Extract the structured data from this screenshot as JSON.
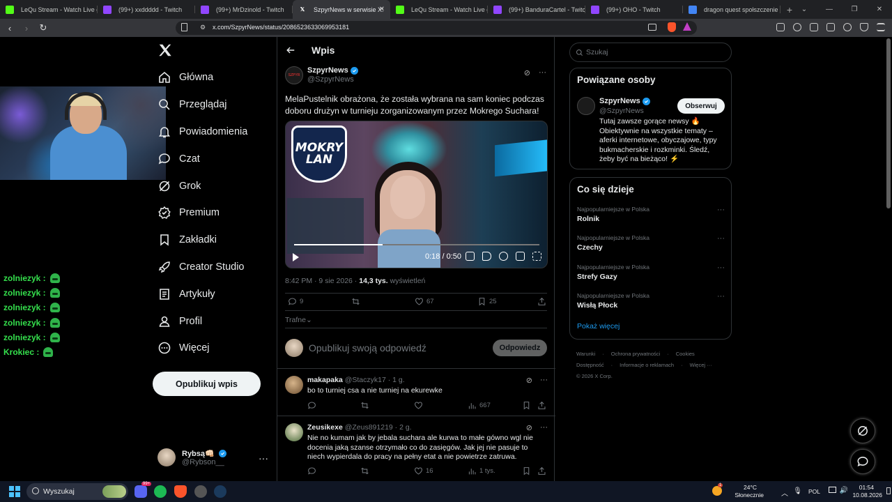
{
  "browser": {
    "tabs": [
      {
        "title": "LeQu Stream - Watch Live on",
        "icon": "kick-icon",
        "color": "#53fc18"
      },
      {
        "title": "(99+) xxddddd - Twitch",
        "icon": "twitch-icon",
        "color": "#9146ff"
      },
      {
        "title": "(99+) MrDzinold - Twitch",
        "icon": "twitch-icon",
        "color": "#9146ff"
      },
      {
        "title": "SzpyrNews w serwisie X:",
        "icon": "x-icon",
        "color": "#ffffff",
        "active": true
      },
      {
        "title": "LeQu Stream - Watch Live on",
        "icon": "kick-icon",
        "color": "#53fc18"
      },
      {
        "title": "(99+) BanduraCartel - Twitch",
        "icon": "twitch-icon",
        "color": "#9146ff"
      },
      {
        "title": "(99+) OHO - Twitch",
        "icon": "twitch-icon",
        "color": "#9146ff"
      },
      {
        "title": "dragon quest społszczenie - G",
        "icon": "google-icon",
        "color": "#4285f4"
      }
    ],
    "url": "x.com/SzpyrNews/status/2086523633069953181"
  },
  "chat": [
    {
      "user": "zolniezyk :"
    },
    {
      "user": "zolniezyk :"
    },
    {
      "user": "zolniezyk :"
    },
    {
      "user": "zolniezyk :"
    },
    {
      "user": "zolniezyk :"
    },
    {
      "user": "Krokiec :"
    }
  ],
  "nav": {
    "items": [
      {
        "label": "Główna",
        "icon": "home-icon"
      },
      {
        "label": "Przeglądaj",
        "icon": "search-icon"
      },
      {
        "label": "Powiadomienia",
        "icon": "bell-icon"
      },
      {
        "label": "Czat",
        "icon": "chat-icon"
      },
      {
        "label": "Grok",
        "icon": "grok-icon"
      },
      {
        "label": "Premium",
        "icon": "premium-icon"
      },
      {
        "label": "Zakładki",
        "icon": "bookmark-icon"
      },
      {
        "label": "Creator Studio",
        "icon": "rocket-icon"
      },
      {
        "label": "Artykuły",
        "icon": "article-icon"
      },
      {
        "label": "Profil",
        "icon": "profile-icon"
      },
      {
        "label": "Więcej",
        "icon": "more-icon"
      }
    ],
    "post_button": "Opublikuj wpis",
    "account": {
      "name": "Rybsą",
      "emoji": "👊🏻",
      "handle": "@Rybson__"
    }
  },
  "post": {
    "header": "Wpis",
    "author_name": "SzpyrNews",
    "author_handle": "@SzpyrNews",
    "avatar_text": "SZPYR",
    "text": "MelaPustelnik obrażona, że została wybrana na sam koniec podczas doboru drużyn w turnieju zorganizowanym przez Mokrego Suchara!",
    "video": {
      "logo_line1": "MOKRY",
      "logo_line2": "LAN",
      "time": "0:18 / 0:50",
      "progress": 0.36
    },
    "time": "8:42 PM · 9 sie 2026 · ",
    "views": "14,3 tys.",
    "views_label": " wyświetleń",
    "stats": {
      "replies": "9",
      "reposts": "",
      "likes": "67",
      "bookmarks": "25"
    },
    "sort": "Trafne",
    "reply_placeholder": "Opublikuj swoją odpowiedź",
    "reply_button": "Odpowiedz"
  },
  "replies": [
    {
      "name": "makapaka",
      "handle": "@Staczyk17 · 1 g.",
      "text": "bo to turniej csa a nie turniej na ekurewke",
      "views": "667",
      "likes": ""
    },
    {
      "name": "Zeusikexe",
      "handle": "@Zeus891219 · 2 g.",
      "text": "Nie no kumam jak by jebala suchara ale kurwa to małe gówno wgl nie docenia jaką szanse otrzymało co do zasięgów. Jak jej nie pasuje to niech wypierdala do pracy na pełny etat a nie powietrze zatruwa.",
      "views": "1 tys.",
      "likes": "16"
    }
  ],
  "sidebar": {
    "search_placeholder": "Szukaj",
    "related_title": "Powiązane osoby",
    "related": {
      "name": "SzpyrNews",
      "handle": "@SzpyrNews",
      "follow": "Obserwuj",
      "bio": "Tutaj zawsze gorące newsy 🔥 Obiektywnie na wszystkie tematy – aferki internetowe, obyczajowe, typy bukmacherskie i rozkminki. Śledź, żeby być na bieżąco! ⚡"
    },
    "trends_title": "Co się dzieje",
    "trends": [
      {
        "context": "Najpopularniejsze w Polska",
        "name": "Rolnik"
      },
      {
        "context": "Najpopularniejsze w Polska",
        "name": "Czechy"
      },
      {
        "context": "Najpopularniejsze w Polska",
        "name": "Strefy Gazy"
      },
      {
        "context": "Najpopularniejsze w Polska",
        "name": "Wisłą Płock"
      }
    ],
    "show_more": "Pokaż więcej",
    "footer_line1": [
      "Warunki",
      "Ochrona prywatności",
      "Cookies"
    ],
    "footer_line2": [
      "Dostępność",
      "Informacje o reklamach",
      "Więcej ···"
    ],
    "copyright": "© 2026 X Corp."
  },
  "taskbar": {
    "search": "Wyszukaj",
    "discord_badge": "99+",
    "weather_temp": "24°C",
    "weather_desc": "Słonecznie",
    "weather_badge": "1",
    "lang": "POL",
    "time": "01:54",
    "date": "10.08.2026"
  },
  "colors": {
    "accent": "#1d9bf0",
    "chat_name": "#35e04d",
    "background": "#000000"
  }
}
